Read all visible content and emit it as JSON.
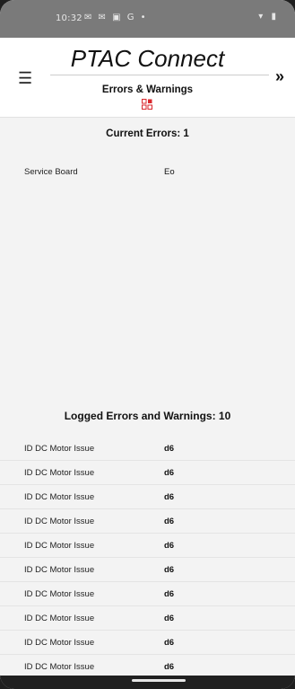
{
  "status_bar": {
    "time": "10:32",
    "icons_left": "✉ ✉ ▣ G •",
    "icons_right": "▾ ▮"
  },
  "header": {
    "app_title": "PTAC Connect",
    "page_subtitle": "Errors & Warnings",
    "menu_icon": "☰",
    "next_icon": "»",
    "accent_color": "#d9262b"
  },
  "current_errors": {
    "title": "Current Errors: 1",
    "rows": [
      {
        "label": "Service Board",
        "code": "Eo"
      }
    ]
  },
  "logged": {
    "title": "Logged Errors and Warnings: 10",
    "rows": [
      {
        "label": "ID DC Motor Issue",
        "code": "d6"
      },
      {
        "label": "ID DC Motor Issue",
        "code": "d6"
      },
      {
        "label": "ID DC Motor Issue",
        "code": "d6"
      },
      {
        "label": "ID DC Motor Issue",
        "code": "d6"
      },
      {
        "label": "ID DC Motor Issue",
        "code": "d6"
      },
      {
        "label": "ID DC Motor Issue",
        "code": "d6"
      },
      {
        "label": "ID DC Motor Issue",
        "code": "d6"
      },
      {
        "label": "ID DC Motor Issue",
        "code": "d6"
      },
      {
        "label": "ID DC Motor Issue",
        "code": "d6"
      },
      {
        "label": "ID DC Motor Issue",
        "code": "d6"
      }
    ]
  }
}
